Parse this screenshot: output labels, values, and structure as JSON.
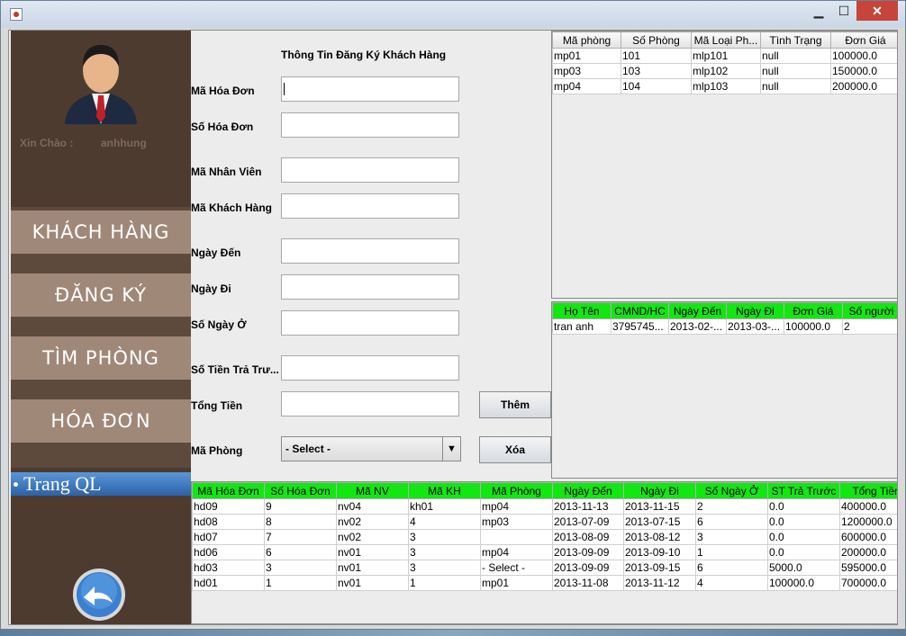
{
  "window": {
    "minimize": "▁",
    "maximize": "☐",
    "close": "✕"
  },
  "sidebar": {
    "greeting": "Xin Chào :",
    "username": "anhhung",
    "nav": [
      "KHÁCH HÀNG",
      "ĐĂNG KÝ",
      "TÌM PHÒNG",
      "HÓA ĐƠN"
    ],
    "manage_label": "Trang QL"
  },
  "form": {
    "title": "Thông Tin Đăng Ký Khách Hàng",
    "labels": [
      "Mã Hóa Đơn",
      "Số Hóa Đơn",
      "Mã Nhân Viên",
      "Mã Khách Hàng",
      "Ngày Đến",
      "Ngày Đi",
      "Số Ngày Ở",
      "Số Tiền Trả Trư...",
      "Tổng Tiền",
      "Mã Phòng"
    ],
    "values": [
      "",
      "",
      "",
      "",
      "",
      "",
      "",
      "",
      ""
    ],
    "add_button": "Thêm",
    "delete_button": "Xóa",
    "room_select": "- Select -",
    "select_arrow": "▼"
  },
  "rooms_table": {
    "columns": [
      "Mã phòng",
      "Số Phòng",
      "Mã Loại Ph...",
      "Tình Trạng",
      "Đơn Giá"
    ],
    "rows": [
      [
        "mp01",
        "101",
        "mlp101",
        "null",
        "100000.0"
      ],
      [
        "mp03",
        "103",
        "mlp102",
        "null",
        "150000.0"
      ],
      [
        "mp04",
        "104",
        "mlp103",
        "null",
        "200000.0"
      ]
    ]
  },
  "guest_table": {
    "columns": [
      "Họ Tên",
      "CMND/HC",
      "Ngày Đến",
      "Ngày Đi",
      "Đơn Giá",
      "Số người"
    ],
    "rows": [
      [
        "tran anh",
        "3795745...",
        "2013-02-...",
        "2013-03-...",
        "100000.0",
        "2"
      ]
    ]
  },
  "invoice_table": {
    "columns": [
      "Mã Hóa Đơn",
      "Số Hóa Đơn",
      "Mã NV",
      "Mã KH",
      "Mã Phòng",
      "Ngày Đến",
      "Ngày Đi",
      "Số Ngày Ở",
      "ST Trả Trước",
      "Tổng Tiền"
    ],
    "rows": [
      [
        "hd09",
        "9",
        "nv04",
        "kh01",
        "mp04",
        "2013-11-13",
        "2013-11-15",
        "2",
        "0.0",
        "400000.0"
      ],
      [
        "hd08",
        "8",
        "nv02",
        "4",
        "mp03",
        "2013-07-09",
        "2013-07-15",
        "6",
        "0.0",
        "1200000.0"
      ],
      [
        "hd07",
        "7",
        "nv02",
        "3",
        "",
        "2013-08-09",
        "2013-08-12",
        "3",
        "0.0",
        "600000.0"
      ],
      [
        "hd06",
        "6",
        "nv01",
        "3",
        "mp04",
        "2013-09-09",
        "2013-09-10",
        "1",
        "0.0",
        "200000.0"
      ],
      [
        "hd03",
        "3",
        "nv01",
        "3",
        "- Select -",
        "2013-09-09",
        "2013-09-15",
        "6",
        "5000.0",
        "595000.0"
      ],
      [
        "hd01",
        "1",
        "nv01",
        "1",
        "mp01",
        "2013-11-08",
        "2013-11-12",
        "4",
        "100000.0",
        "700000.0"
      ]
    ]
  }
}
